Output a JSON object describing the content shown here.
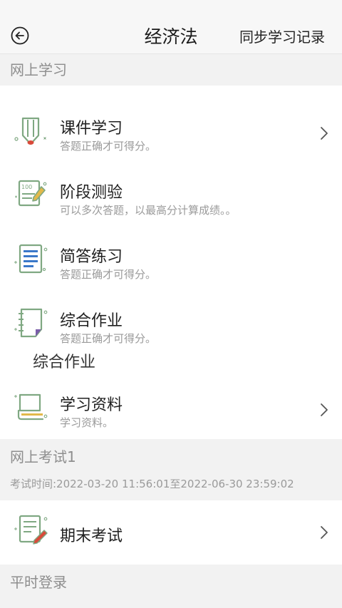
{
  "header": {
    "title": "经济法",
    "sync_link": "同步学习记录",
    "back_icon": "back-arrow-circle-icon"
  },
  "online_learning": {
    "heading": "网上学习",
    "items": [
      {
        "title": "课件学习",
        "subtitle": "答题正确才可得分。",
        "icon": "courseware-pencil-icon",
        "has_chevron": true
      },
      {
        "title": "阶段测验",
        "subtitle": "可以多次答题，以最高分计算成绩。。",
        "icon": "stage-test-icon",
        "has_chevron": false
      },
      {
        "title": "简答练习",
        "subtitle": "答题正确才可得分。",
        "icon": "short-answer-doc-icon",
        "has_chevron": false
      },
      {
        "title": "综合作业",
        "subtitle": "答题正确才可得分。",
        "icon": "notebook-icon",
        "has_chevron": false
      }
    ],
    "group_label": "综合作业",
    "materials": {
      "title": "学习资料",
      "subtitle": "学习资料。",
      "icon": "book-icon",
      "has_chevron": true
    }
  },
  "online_exam": {
    "heading": "网上考试1",
    "time": "考试时间:2022-03-20 11:56:01至2022-06-30 23:59:02",
    "items": [
      {
        "title": "期末考试",
        "icon": "exam-paper-pen-icon",
        "has_chevron": true
      }
    ]
  },
  "regular_login": {
    "heading": "平时登录"
  },
  "colors": {
    "icon_green": "#7fa882",
    "accent_red": "#d94a3a",
    "accent_blue": "#3a78c9",
    "accent_purple": "#7a5ea8",
    "accent_yellow": "#e2b94a"
  }
}
